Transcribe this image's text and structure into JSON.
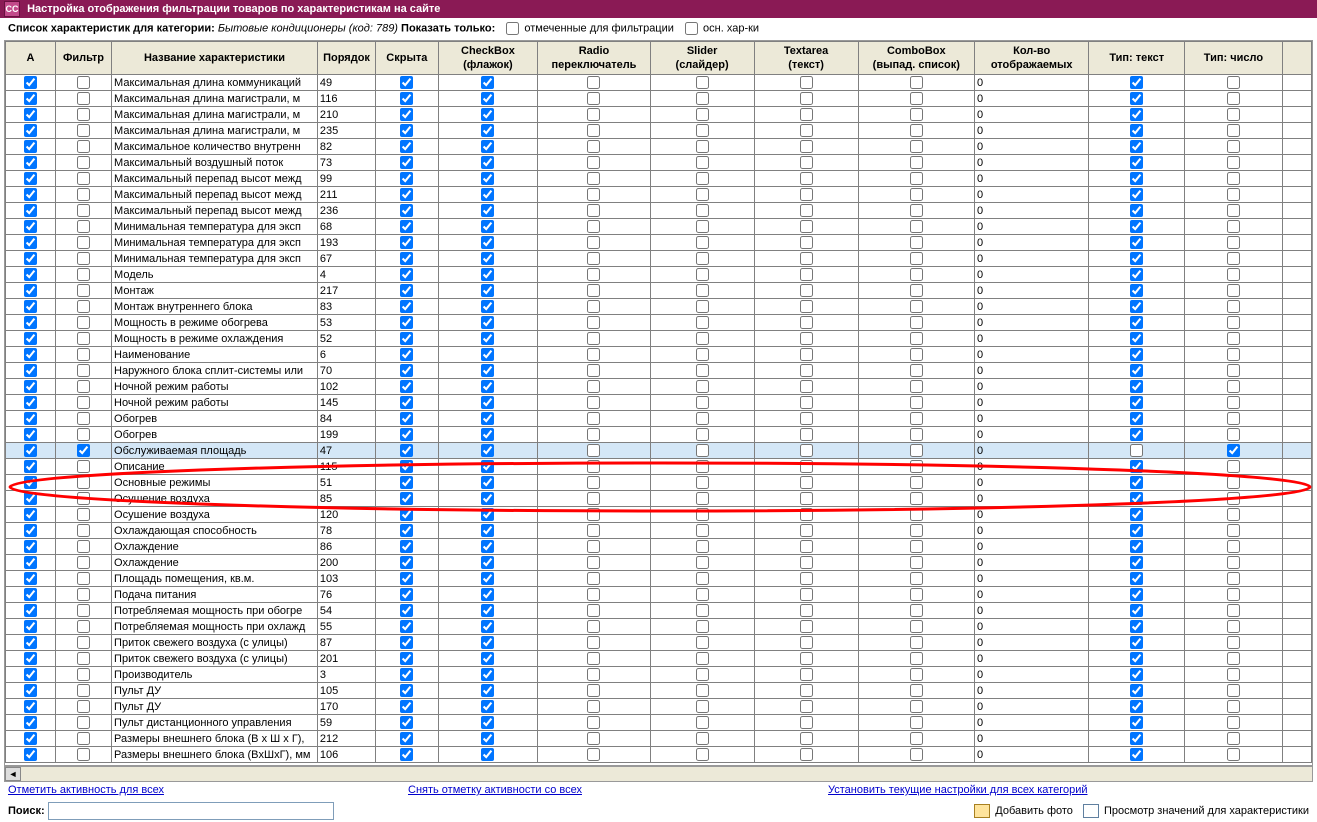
{
  "title": "Настройка отображения  фильтрации товаров по характеристикам на сайте",
  "icon_text": "CC",
  "topbar": {
    "list_label": "Список характеристик для категории:",
    "category": "Бытовые кондиционеры (код: 789)",
    "show_only": "Показать только:",
    "cb1_label": "отмеченные для фильтрации",
    "cb2_label": "осн. хар-ки"
  },
  "headers": {
    "a": "А",
    "filter": "Фильтр",
    "name": "Название характеристики",
    "order": "Порядок",
    "hidden": "Скрыта",
    "checkbox1": "CheckBox",
    "checkbox2": "(флажок)",
    "radio1": "Radio",
    "radio2": "переключатель",
    "slider1": "Slider",
    "slider2": "(слайдер)",
    "textarea1": "Textarea",
    "textarea2": "(текст)",
    "combo1": "ComboBox",
    "combo2": "(выпад. список)",
    "count1": "Кол-во",
    "count2": "отображаемых",
    "type_text": "Тип: текст",
    "type_num": "Тип: число"
  },
  "rows": [
    {
      "a": true,
      "f": false,
      "name": "Максимальная длина коммуникаций",
      "order": "49",
      "h": true,
      "cb": true,
      "r": false,
      "sl": false,
      "ta": false,
      "co": false,
      "k": "0",
      "tt": true,
      "tn": false
    },
    {
      "a": true,
      "f": false,
      "name": "Максимальная длина магистрали, м",
      "order": "116",
      "h": true,
      "cb": true,
      "r": false,
      "sl": false,
      "ta": false,
      "co": false,
      "k": "0",
      "tt": true,
      "tn": false
    },
    {
      "a": true,
      "f": false,
      "name": "Максимальная длина магистрали, м",
      "order": "210",
      "h": true,
      "cb": true,
      "r": false,
      "sl": false,
      "ta": false,
      "co": false,
      "k": "0",
      "tt": true,
      "tn": false
    },
    {
      "a": true,
      "f": false,
      "name": "Максимальная длина магистрали, м",
      "order": "235",
      "h": true,
      "cb": true,
      "r": false,
      "sl": false,
      "ta": false,
      "co": false,
      "k": "0",
      "tt": true,
      "tn": false
    },
    {
      "a": true,
      "f": false,
      "name": "Максимальное количество внутренн",
      "order": "82",
      "h": true,
      "cb": true,
      "r": false,
      "sl": false,
      "ta": false,
      "co": false,
      "k": "0",
      "tt": true,
      "tn": false
    },
    {
      "a": true,
      "f": false,
      "name": "Максимальный воздушный поток",
      "order": "73",
      "h": true,
      "cb": true,
      "r": false,
      "sl": false,
      "ta": false,
      "co": false,
      "k": "0",
      "tt": true,
      "tn": false
    },
    {
      "a": true,
      "f": false,
      "name": "Максимальный перепад высот межд",
      "order": "99",
      "h": true,
      "cb": true,
      "r": false,
      "sl": false,
      "ta": false,
      "co": false,
      "k": "0",
      "tt": true,
      "tn": false
    },
    {
      "a": true,
      "f": false,
      "name": "Максимальный перепад высот межд",
      "order": "211",
      "h": true,
      "cb": true,
      "r": false,
      "sl": false,
      "ta": false,
      "co": false,
      "k": "0",
      "tt": true,
      "tn": false
    },
    {
      "a": true,
      "f": false,
      "name": "Максимальный перепад высот межд",
      "order": "236",
      "h": true,
      "cb": true,
      "r": false,
      "sl": false,
      "ta": false,
      "co": false,
      "k": "0",
      "tt": true,
      "tn": false
    },
    {
      "a": true,
      "f": false,
      "name": "Минимальная температура для эксп",
      "order": "68",
      "h": true,
      "cb": true,
      "r": false,
      "sl": false,
      "ta": false,
      "co": false,
      "k": "0",
      "tt": true,
      "tn": false
    },
    {
      "a": true,
      "f": false,
      "name": "Минимальная температура для эксп",
      "order": "193",
      "h": true,
      "cb": true,
      "r": false,
      "sl": false,
      "ta": false,
      "co": false,
      "k": "0",
      "tt": true,
      "tn": false
    },
    {
      "a": true,
      "f": false,
      "name": "Минимальная температура для эксп",
      "order": "67",
      "h": true,
      "cb": true,
      "r": false,
      "sl": false,
      "ta": false,
      "co": false,
      "k": "0",
      "tt": true,
      "tn": false
    },
    {
      "a": true,
      "f": false,
      "name": "Модель",
      "order": "4",
      "h": true,
      "cb": true,
      "r": false,
      "sl": false,
      "ta": false,
      "co": false,
      "k": "0",
      "tt": true,
      "tn": false
    },
    {
      "a": true,
      "f": false,
      "name": "Монтаж",
      "order": "217",
      "h": true,
      "cb": true,
      "r": false,
      "sl": false,
      "ta": false,
      "co": false,
      "k": "0",
      "tt": true,
      "tn": false
    },
    {
      "a": true,
      "f": false,
      "name": "Монтаж внутреннего блока",
      "order": "83",
      "h": true,
      "cb": true,
      "r": false,
      "sl": false,
      "ta": false,
      "co": false,
      "k": "0",
      "tt": true,
      "tn": false
    },
    {
      "a": true,
      "f": false,
      "name": "Мощность в режиме обогрева",
      "order": "53",
      "h": true,
      "cb": true,
      "r": false,
      "sl": false,
      "ta": false,
      "co": false,
      "k": "0",
      "tt": true,
      "tn": false
    },
    {
      "a": true,
      "f": false,
      "name": "Мощность в режиме охлаждения",
      "order": "52",
      "h": true,
      "cb": true,
      "r": false,
      "sl": false,
      "ta": false,
      "co": false,
      "k": "0",
      "tt": true,
      "tn": false
    },
    {
      "a": true,
      "f": false,
      "name": "Наименование",
      "order": "6",
      "h": true,
      "cb": true,
      "r": false,
      "sl": false,
      "ta": false,
      "co": false,
      "k": "0",
      "tt": true,
      "tn": false
    },
    {
      "a": true,
      "f": false,
      "name": "Наружного блока сплит-системы или",
      "order": "70",
      "h": true,
      "cb": true,
      "r": false,
      "sl": false,
      "ta": false,
      "co": false,
      "k": "0",
      "tt": true,
      "tn": false
    },
    {
      "a": true,
      "f": false,
      "name": "Ночной режим работы",
      "order": "102",
      "h": true,
      "cb": true,
      "r": false,
      "sl": false,
      "ta": false,
      "co": false,
      "k": "0",
      "tt": true,
      "tn": false
    },
    {
      "a": true,
      "f": false,
      "name": "Ночной режим работы",
      "order": "145",
      "h": true,
      "cb": true,
      "r": false,
      "sl": false,
      "ta": false,
      "co": false,
      "k": "0",
      "tt": true,
      "tn": false
    },
    {
      "a": true,
      "f": false,
      "name": "Обогрев",
      "order": "84",
      "h": true,
      "cb": true,
      "r": false,
      "sl": false,
      "ta": false,
      "co": false,
      "k": "0",
      "tt": true,
      "tn": false
    },
    {
      "a": true,
      "f": false,
      "name": "Обогрев",
      "order": "199",
      "h": true,
      "cb": true,
      "r": false,
      "sl": false,
      "ta": false,
      "co": false,
      "k": "0",
      "tt": true,
      "tn": false
    },
    {
      "a": true,
      "f": true,
      "name": "Обслуживаемая площадь",
      "order": "47",
      "h": true,
      "cb": true,
      "r": false,
      "sl": false,
      "ta": false,
      "co": false,
      "k": "0",
      "tt": false,
      "tn": true,
      "sel": true
    },
    {
      "a": true,
      "f": false,
      "name": "Описание",
      "order": "115",
      "h": true,
      "cb": true,
      "r": false,
      "sl": false,
      "ta": false,
      "co": false,
      "k": "0",
      "tt": true,
      "tn": false
    },
    {
      "a": true,
      "f": false,
      "name": "Основные режимы",
      "order": "51",
      "h": true,
      "cb": true,
      "r": false,
      "sl": false,
      "ta": false,
      "co": false,
      "k": "0",
      "tt": true,
      "tn": false
    },
    {
      "a": true,
      "f": false,
      "name": "Осушение воздуха",
      "order": "85",
      "h": true,
      "cb": true,
      "r": false,
      "sl": false,
      "ta": false,
      "co": false,
      "k": "0",
      "tt": true,
      "tn": false
    },
    {
      "a": true,
      "f": false,
      "name": "Осушение воздуха",
      "order": "120",
      "h": true,
      "cb": true,
      "r": false,
      "sl": false,
      "ta": false,
      "co": false,
      "k": "0",
      "tt": true,
      "tn": false
    },
    {
      "a": true,
      "f": false,
      "name": "Охлаждающая способность",
      "order": "78",
      "h": true,
      "cb": true,
      "r": false,
      "sl": false,
      "ta": false,
      "co": false,
      "k": "0",
      "tt": true,
      "tn": false
    },
    {
      "a": true,
      "f": false,
      "name": "Охлаждение",
      "order": "86",
      "h": true,
      "cb": true,
      "r": false,
      "sl": false,
      "ta": false,
      "co": false,
      "k": "0",
      "tt": true,
      "tn": false
    },
    {
      "a": true,
      "f": false,
      "name": "Охлаждение",
      "order": "200",
      "h": true,
      "cb": true,
      "r": false,
      "sl": false,
      "ta": false,
      "co": false,
      "k": "0",
      "tt": true,
      "tn": false
    },
    {
      "a": true,
      "f": false,
      "name": "Площадь помещения, кв.м.",
      "order": "103",
      "h": true,
      "cb": true,
      "r": false,
      "sl": false,
      "ta": false,
      "co": false,
      "k": "0",
      "tt": true,
      "tn": false
    },
    {
      "a": true,
      "f": false,
      "name": "Подача питания",
      "order": "76",
      "h": true,
      "cb": true,
      "r": false,
      "sl": false,
      "ta": false,
      "co": false,
      "k": "0",
      "tt": true,
      "tn": false
    },
    {
      "a": true,
      "f": false,
      "name": "Потребляемая мощность при обогре",
      "order": "54",
      "h": true,
      "cb": true,
      "r": false,
      "sl": false,
      "ta": false,
      "co": false,
      "k": "0",
      "tt": true,
      "tn": false
    },
    {
      "a": true,
      "f": false,
      "name": "Потребляемая мощность при охлажд",
      "order": "55",
      "h": true,
      "cb": true,
      "r": false,
      "sl": false,
      "ta": false,
      "co": false,
      "k": "0",
      "tt": true,
      "tn": false
    },
    {
      "a": true,
      "f": false,
      "name": "Приток свежего воздуха (с улицы)",
      "order": "87",
      "h": true,
      "cb": true,
      "r": false,
      "sl": false,
      "ta": false,
      "co": false,
      "k": "0",
      "tt": true,
      "tn": false
    },
    {
      "a": true,
      "f": false,
      "name": "Приток свежего воздуха (с улицы)",
      "order": "201",
      "h": true,
      "cb": true,
      "r": false,
      "sl": false,
      "ta": false,
      "co": false,
      "k": "0",
      "tt": true,
      "tn": false
    },
    {
      "a": true,
      "f": false,
      "name": "Производитель",
      "order": "3",
      "h": true,
      "cb": true,
      "r": false,
      "sl": false,
      "ta": false,
      "co": false,
      "k": "0",
      "tt": true,
      "tn": false
    },
    {
      "a": true,
      "f": false,
      "name": "Пульт ДУ",
      "order": "105",
      "h": true,
      "cb": true,
      "r": false,
      "sl": false,
      "ta": false,
      "co": false,
      "k": "0",
      "tt": true,
      "tn": false
    },
    {
      "a": true,
      "f": false,
      "name": "Пульт ДУ",
      "order": "170",
      "h": true,
      "cb": true,
      "r": false,
      "sl": false,
      "ta": false,
      "co": false,
      "k": "0",
      "tt": true,
      "tn": false
    },
    {
      "a": true,
      "f": false,
      "name": "Пульт дистанционного управления",
      "order": "59",
      "h": true,
      "cb": true,
      "r": false,
      "sl": false,
      "ta": false,
      "co": false,
      "k": "0",
      "tt": true,
      "tn": false
    },
    {
      "a": true,
      "f": false,
      "name": "Размеры внешнего блока (В x Ш x Г),",
      "order": "212",
      "h": true,
      "cb": true,
      "r": false,
      "sl": false,
      "ta": false,
      "co": false,
      "k": "0",
      "tt": true,
      "tn": false
    },
    {
      "a": true,
      "f": false,
      "name": "Размеры внешнего блока (ВxШxГ), мм",
      "order": "106",
      "h": true,
      "cb": true,
      "r": false,
      "sl": false,
      "ta": false,
      "co": false,
      "k": "0",
      "tt": true,
      "tn": false
    }
  ],
  "links": {
    "mark_all": "Отметить активность для всех",
    "unmark_all": "Снять отметку активности со всех",
    "set_all_cat": "Установить текущие настройки для всех категорий"
  },
  "bottom": {
    "search_label": "Поиск:",
    "add_photo": "Добавить фото",
    "view_values": "Просмотр значений для характеристики"
  }
}
